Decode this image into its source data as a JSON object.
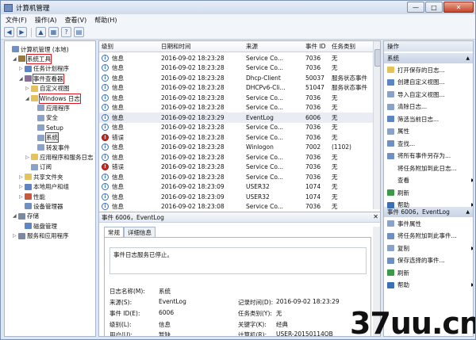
{
  "window": {
    "title": "计算机管理",
    "min": "—",
    "max": "□",
    "close": "✕"
  },
  "menu": [
    "文件(F)",
    "操作(A)",
    "查看(V)",
    "帮助(H)"
  ],
  "tree": [
    {
      "label": "计算机管理 (本地)",
      "indent": 0,
      "arrow": "",
      "color": "#6f8fc2",
      "hl": false
    },
    {
      "label": "系统工具",
      "indent": 1,
      "arrow": "◢",
      "color": "#9a7a3c",
      "hl": true
    },
    {
      "label": "任务计划程序",
      "indent": 2,
      "arrow": "▷",
      "color": "#5c85c6",
      "hl": false
    },
    {
      "label": "事件查看器",
      "indent": 2,
      "arrow": "◢",
      "color": "#8a6f9c",
      "hl": true
    },
    {
      "label": "自定义视图",
      "indent": 3,
      "arrow": "▷",
      "color": "#e6c35a",
      "hl": false
    },
    {
      "label": "Windows 日志",
      "indent": 3,
      "arrow": "◢",
      "color": "#e6c35a",
      "hl": true
    },
    {
      "label": "应用程序",
      "indent": 4,
      "arrow": "",
      "color": "#8aa2c8",
      "hl": false
    },
    {
      "label": "安全",
      "indent": 4,
      "arrow": "",
      "color": "#8aa2c8",
      "hl": false
    },
    {
      "label": "Setup",
      "indent": 4,
      "arrow": "",
      "color": "#8aa2c8",
      "hl": false
    },
    {
      "label": "系统",
      "indent": 4,
      "arrow": "",
      "color": "#8aa2c8",
      "hl": true
    },
    {
      "label": "转发事件",
      "indent": 4,
      "arrow": "",
      "color": "#8aa2c8",
      "hl": false
    },
    {
      "label": "应用程序和服务日志",
      "indent": 3,
      "arrow": "▷",
      "color": "#e6c35a",
      "hl": false
    },
    {
      "label": "订阅",
      "indent": 3,
      "arrow": "",
      "color": "#8aa2c8",
      "hl": false
    },
    {
      "label": "共享文件夹",
      "indent": 2,
      "arrow": "▷",
      "color": "#e6c35a",
      "hl": false
    },
    {
      "label": "本地用户和组",
      "indent": 2,
      "arrow": "▷",
      "color": "#5c85c6",
      "hl": false
    },
    {
      "label": "性能",
      "indent": 2,
      "arrow": "▷",
      "color": "#c85a3c",
      "hl": false
    },
    {
      "label": "设备管理器",
      "indent": 2,
      "arrow": "",
      "color": "#6f8fc2",
      "hl": false
    },
    {
      "label": "存储",
      "indent": 1,
      "arrow": "◢",
      "color": "#7a8aa0",
      "hl": false
    },
    {
      "label": "磁盘管理",
      "indent": 2,
      "arrow": "",
      "color": "#5c85c6",
      "hl": false
    },
    {
      "label": "服务和应用程序",
      "indent": 1,
      "arrow": "▷",
      "color": "#7a8aa0",
      "hl": false
    }
  ],
  "grid": {
    "headers": [
      "级别",
      "日期和时间",
      "来源",
      "事件 ID",
      "任务类别"
    ],
    "rows": [
      {
        "level": "信息",
        "type": "info",
        "time": "2016-09-02 18:23:28",
        "source": "Service Co...",
        "id": "7036",
        "cat": "无"
      },
      {
        "level": "信息",
        "type": "info",
        "time": "2016-09-02 18:23:28",
        "source": "Service Co...",
        "id": "7036",
        "cat": "无"
      },
      {
        "level": "信息",
        "type": "info",
        "time": "2016-09-02 18:23:28",
        "source": "Dhcp-Client",
        "id": "50037",
        "cat": "服务状态事件"
      },
      {
        "level": "信息",
        "type": "info",
        "time": "2016-09-02 18:23:28",
        "source": "DHCPv6-Cli...",
        "id": "51047",
        "cat": "服务状态事件"
      },
      {
        "level": "信息",
        "type": "info",
        "time": "2016-09-02 18:23:28",
        "source": "Service Co...",
        "id": "7036",
        "cat": "无"
      },
      {
        "level": "信息",
        "type": "info",
        "time": "2016-09-02 18:23:28",
        "source": "Service Co...",
        "id": "7036",
        "cat": "无"
      },
      {
        "level": "信息",
        "type": "info",
        "time": "2016-09-02 18:23:29",
        "source": "EventLog",
        "id": "6006",
        "cat": "无"
      },
      {
        "level": "信息",
        "type": "info",
        "time": "2016-09-02 18:23:28",
        "source": "Service Co...",
        "id": "7036",
        "cat": "无"
      },
      {
        "level": "错误",
        "type": "err",
        "time": "2016-09-02 18:23:28",
        "source": "Service Co...",
        "id": "7036",
        "cat": "无"
      },
      {
        "level": "信息",
        "type": "info",
        "time": "2016-09-02 18:23:28",
        "source": "Winlogon",
        "id": "7002",
        "cat": "(1102)"
      },
      {
        "level": "信息",
        "type": "info",
        "time": "2016-09-02 18:23:28",
        "source": "Service Co...",
        "id": "7036",
        "cat": "无"
      },
      {
        "level": "错误",
        "type": "err",
        "time": "2016-09-02 18:23:28",
        "source": "Service Co...",
        "id": "7036",
        "cat": "无"
      },
      {
        "level": "信息",
        "type": "info",
        "time": "2016-09-02 18:23:28",
        "source": "Service Co...",
        "id": "7036",
        "cat": "无"
      },
      {
        "level": "信息",
        "type": "info",
        "time": "2016-09-02 18:23:09",
        "source": "USER32",
        "id": "1074",
        "cat": "无"
      },
      {
        "level": "信息",
        "type": "info",
        "time": "2016-09-02 18:23:09",
        "source": "USER32",
        "id": "1074",
        "cat": "无"
      },
      {
        "level": "信息",
        "type": "info",
        "time": "2016-09-02 18:23:08",
        "source": "Service Co...",
        "id": "7036",
        "cat": "无"
      }
    ]
  },
  "detail": {
    "header": "事件 6006，EventLog",
    "close": "✕",
    "tabs": [
      "常规",
      "详细信息"
    ],
    "message": "事件日志服务已停止。",
    "log_name_label": "日志名称(M):",
    "log_name": "系统",
    "source_label": "来源(S):",
    "source": "EventLog",
    "recorded_label": "记录时间(D):",
    "recorded": "2016-09-02 18:23:29",
    "event_id_label": "事件 ID(E):",
    "event_id": "6006",
    "task_label": "任务类别(Y):",
    "task": "无",
    "level_label": "级别(L):",
    "level": "信息",
    "keyword_label": "关键字(K):",
    "keyword": "经典",
    "user_label": "用户(U):",
    "user": "暂缺",
    "computer_label": "计算机(R):",
    "computer": "USER-20150114OB"
  },
  "actions": {
    "title": "操作",
    "sec1": "系统",
    "items1": [
      {
        "label": "打开保存的日志...",
        "color": "#e6c35a"
      },
      {
        "label": "创建自定义视图...",
        "color": "#5c85c6"
      },
      {
        "label": "导入自定义视图...",
        "color": "#8aa2c8"
      },
      {
        "label": "清除日志...",
        "color": "#8aa2c8"
      },
      {
        "label": "筛选当前日志...",
        "color": "#5c85c6"
      },
      {
        "label": "属性",
        "color": "#8aa2c8"
      },
      {
        "label": "查找...",
        "color": "#6f8fc2"
      },
      {
        "label": "将所有事件另存为...",
        "color": "#6f8fc2"
      },
      {
        "label": "将任务附加到此日志...",
        "color": "#fff"
      },
      {
        "label": "查看",
        "color": "#fff",
        "sub": true
      },
      {
        "label": "刷新",
        "color": "#3a9a4a"
      },
      {
        "label": "帮助",
        "color": "#3a6fb8",
        "sub": true
      }
    ],
    "sec2": "事件 6006，EventLog",
    "items2": [
      {
        "label": "事件属性",
        "color": "#8aa2c8"
      },
      {
        "label": "将任务附加到此事件...",
        "color": "#6f8fc2"
      },
      {
        "label": "复制",
        "color": "#8aa2c8",
        "sub": true
      },
      {
        "label": "保存选择的事件...",
        "color": "#6f8fc2"
      },
      {
        "label": "刷新",
        "color": "#3a9a4a"
      },
      {
        "label": "帮助",
        "color": "#3a6fb8",
        "sub": true
      }
    ]
  },
  "watermark": "37uu.cn"
}
